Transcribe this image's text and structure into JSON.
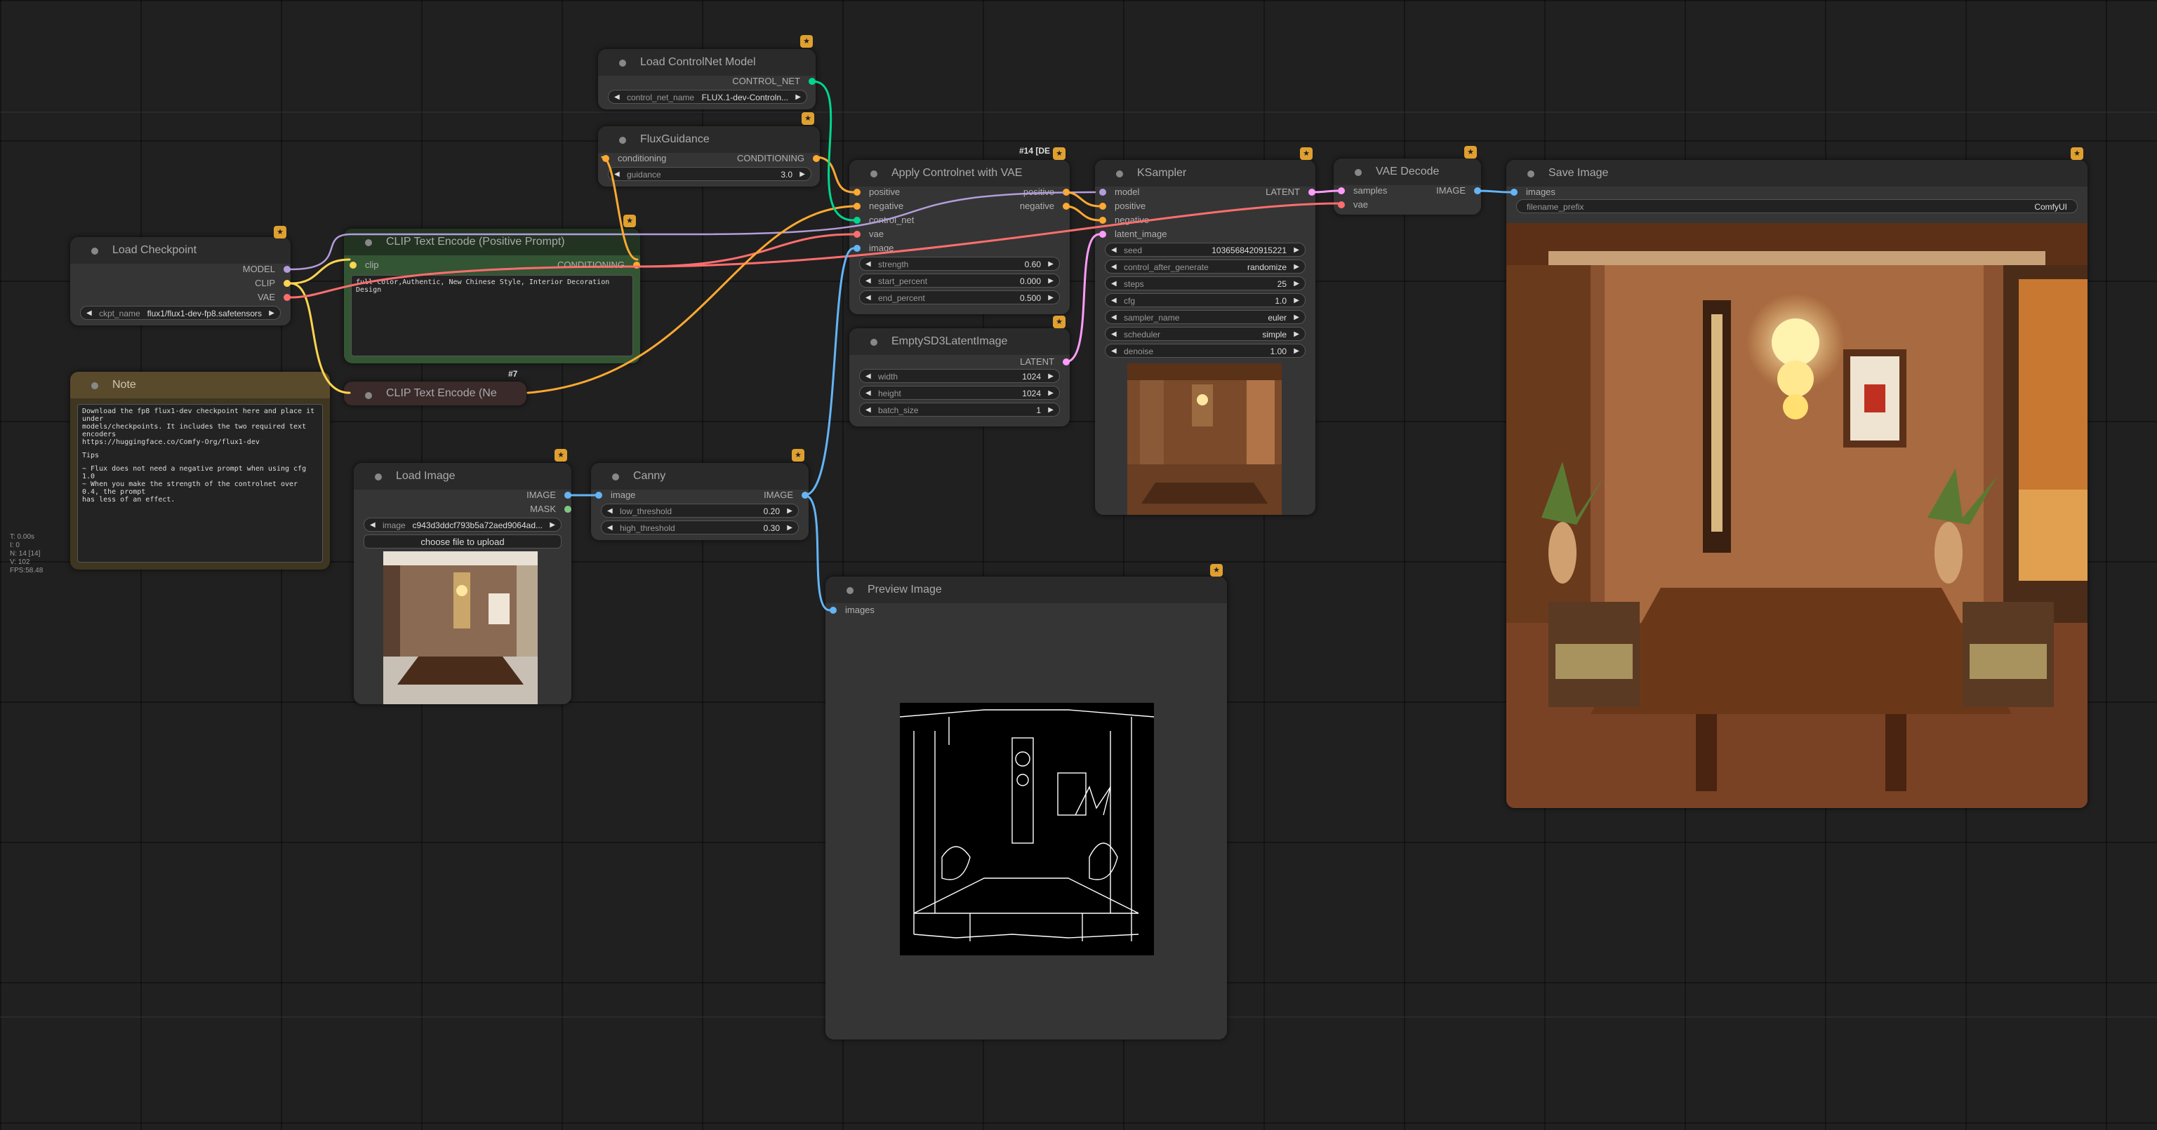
{
  "colors": {
    "model": "#b39ddb",
    "clip": "#ffd54f",
    "vae": "#ff6e6e",
    "conditioning": "#ffa931",
    "image": "#64b5f6",
    "mask": "#81c784",
    "latent": "#ff9cf9",
    "control_net": "#00d78d",
    "note_bg": "#2e2a1e"
  },
  "nodes": {
    "load_checkpoint": {
      "title": "Load Checkpoint",
      "outputs": [
        "MODEL",
        "CLIP",
        "VAE"
      ],
      "widget_label": "ckpt_name",
      "widget_value": "flux1/flux1-dev-fp8.safetensors"
    },
    "load_controlnet": {
      "title": "Load ControlNet Model",
      "output": "CONTROL_NET",
      "widget_label": "control_net_name",
      "widget_value": "FLUX.1-dev-Controln..."
    },
    "flux_guidance": {
      "title": "FluxGuidance",
      "input": "conditioning",
      "output": "CONDITIONING",
      "widget_label": "guidance",
      "widget_value": "3.0"
    },
    "clip_pos": {
      "title": "CLIP Text Encode (Positive Prompt)",
      "input": "clip",
      "output": "CONDITIONING",
      "text": "full color,Authentic, New Chinese Style, Interior Decoration Design"
    },
    "clip_neg": {
      "title": "CLIP Text Encode (Ne",
      "id": "#7"
    },
    "note": {
      "title": "Note",
      "lines": [
        "Download the fp8 flux1-dev checkpoint here and place it under",
        "models/checkpoints. It includes the two required text encoders",
        "https://huggingface.co/Comfy-Org/flux1-dev",
        "",
        "Tips",
        "",
        "~ Flux does not need a negative prompt when using cfg 1.0",
        "~ When you make the strength of the controlnet over 0.4, the prompt",
        "has less of an effect."
      ]
    },
    "apply_controlnet": {
      "title": "Apply Controlnet with VAE",
      "id": "#14 [DE",
      "inputs": [
        "positive",
        "negative",
        "control_net",
        "vae",
        "image"
      ],
      "outputs": [
        "positive",
        "negative"
      ],
      "widgets": [
        {
          "label": "strength",
          "value": "0.60"
        },
        {
          "label": "start_percent",
          "value": "0.000"
        },
        {
          "label": "end_percent",
          "value": "0.500"
        }
      ]
    },
    "empty_latent": {
      "title": "EmptySD3LatentImage",
      "output": "LATENT",
      "widgets": [
        {
          "label": "width",
          "value": "1024"
        },
        {
          "label": "height",
          "value": "1024"
        },
        {
          "label": "batch_size",
          "value": "1"
        }
      ]
    },
    "ksampler": {
      "title": "KSampler",
      "inputs": [
        "model",
        "positive",
        "negative",
        "latent_image"
      ],
      "output": "LATENT",
      "widgets": [
        {
          "label": "seed",
          "value": "1036568420915221"
        },
        {
          "label": "control_after_generate",
          "value": "randomize"
        },
        {
          "label": "steps",
          "value": "25"
        },
        {
          "label": "cfg",
          "value": "1.0"
        },
        {
          "label": "sampler_name",
          "value": "euler"
        },
        {
          "label": "scheduler",
          "value": "simple"
        },
        {
          "label": "denoise",
          "value": "1.00"
        }
      ]
    },
    "vae_decode": {
      "title": "VAE Decode",
      "inputs": [
        "samples",
        "vae"
      ],
      "output": "IMAGE"
    },
    "save_image": {
      "title": "Save Image",
      "input": "images",
      "widget_label": "filename_prefix",
      "widget_value": "ComfyUI"
    },
    "load_image": {
      "title": "Load Image",
      "outputs": [
        "IMAGE",
        "MASK"
      ],
      "widget_label": "image",
      "widget_value": "c943d3ddcf793b5a72aed9064ad...",
      "upload_label": "choose file to upload"
    },
    "canny": {
      "title": "Canny",
      "input": "image",
      "output": "IMAGE",
      "widgets": [
        {
          "label": "low_threshold",
          "value": "0.20"
        },
        {
          "label": "high_threshold",
          "value": "0.30"
        }
      ]
    },
    "preview_image": {
      "title": "Preview Image",
      "input": "images"
    }
  },
  "stats": [
    "T: 0.00s",
    "I: 0",
    "N: 14 [14]",
    "V: 102",
    "FPS:58.48"
  ]
}
